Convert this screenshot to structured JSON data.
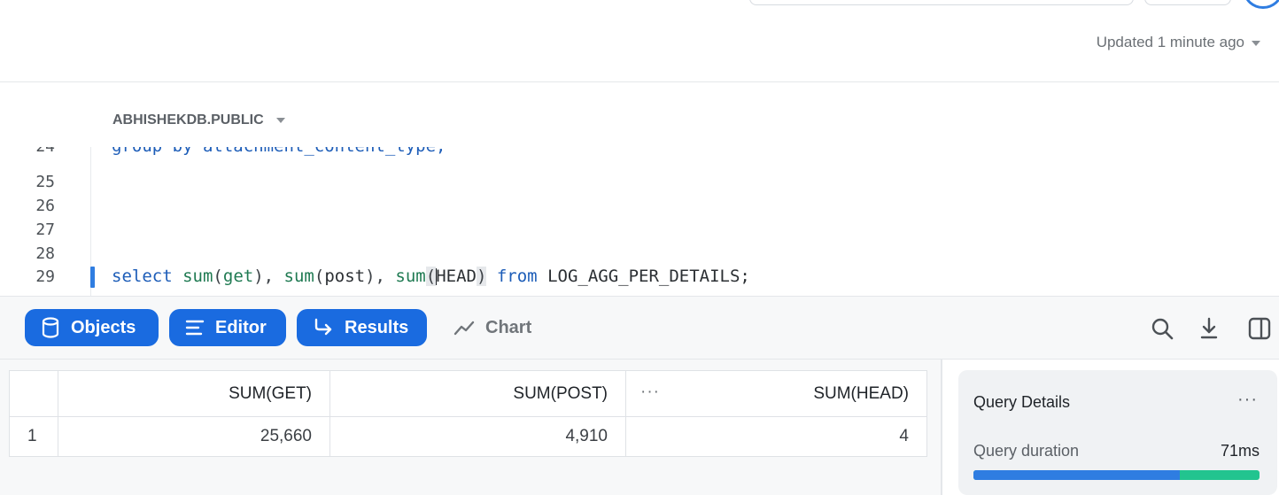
{
  "header": {
    "updated_text": "Updated 1 minute ago"
  },
  "editor": {
    "context": "ABHISHEKDB.PUBLIC",
    "lines": [
      {
        "num": "24",
        "partial": "group by attachment_content_type;"
      },
      {
        "num": "25"
      },
      {
        "num": "26"
      },
      {
        "num": "27"
      },
      {
        "num": "28"
      },
      {
        "num": "29"
      }
    ],
    "query_tokens": {
      "select": "select",
      "sum": "sum",
      "get": "get",
      "post": "post",
      "head": "HEAD",
      "from": "from",
      "table": "LOG_AGG_PER_DETAILS;"
    }
  },
  "toolbar": {
    "objects_label": "Objects",
    "editor_label": "Editor",
    "results_label": "Results",
    "chart_label": "Chart",
    "icons": [
      "database-icon",
      "editor-lines-icon",
      "return-arrow-icon",
      "chart-line-icon",
      "search-icon",
      "download-icon",
      "split-panel-icon"
    ],
    "accent": "#1a6be0"
  },
  "results": {
    "columns": [
      "SUM(GET)",
      "SUM(POST)",
      "SUM(HEAD)"
    ],
    "head_menu": "···",
    "rows": [
      {
        "row": "1",
        "cells": [
          "25,660",
          "4,910",
          "4"
        ]
      }
    ]
  },
  "query_details": {
    "title": "Query Details",
    "more": "···",
    "duration_label": "Query duration",
    "duration_value": "71ms",
    "duration_fraction": 0.72,
    "colors": {
      "primary": "#2f7de1",
      "secondary": "#22c48f"
    }
  }
}
